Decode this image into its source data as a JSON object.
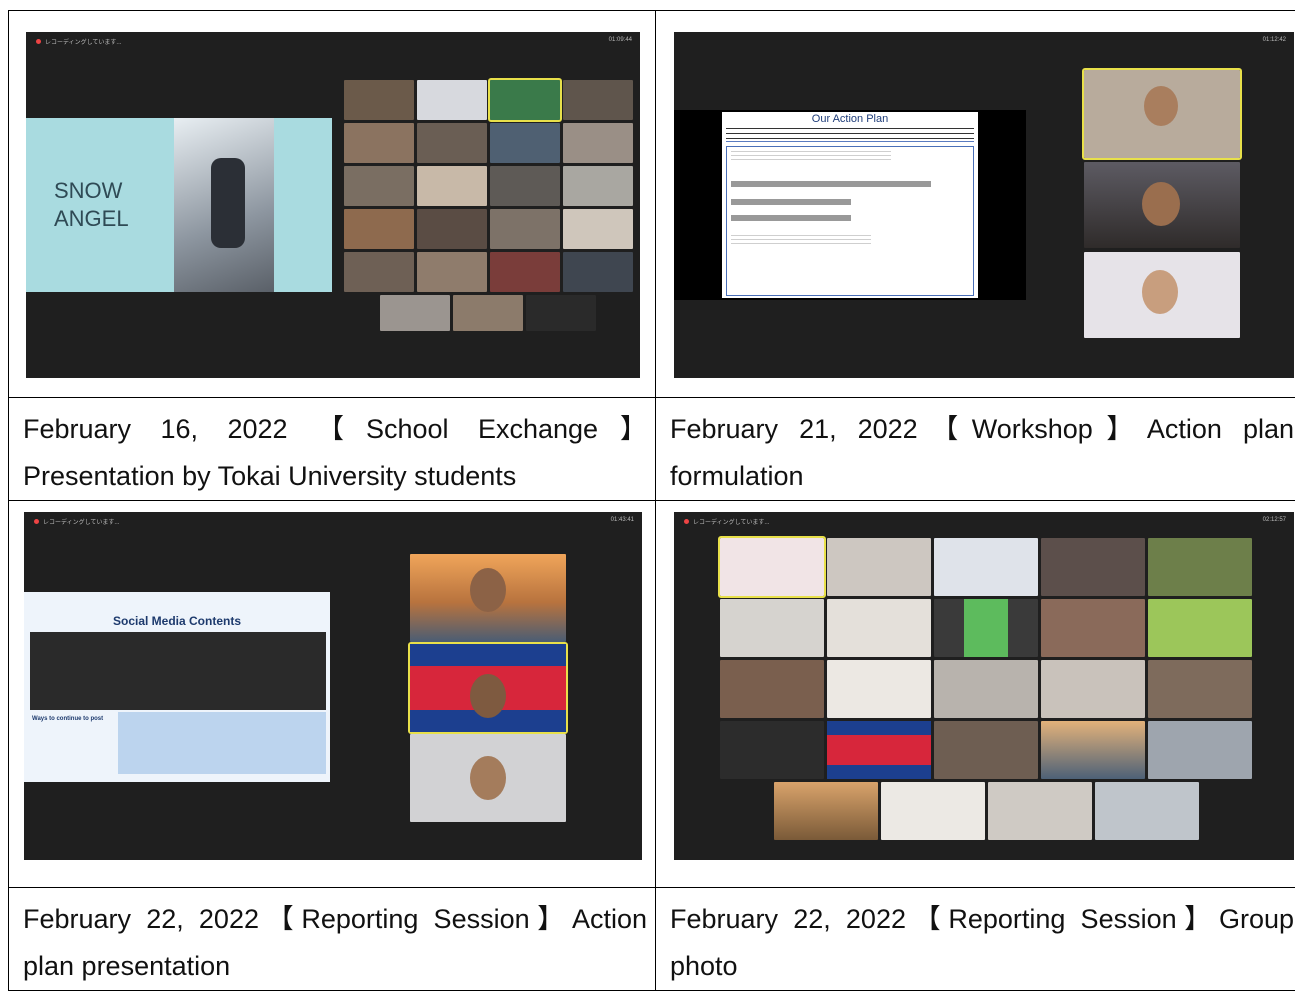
{
  "captions": [
    {
      "text": "February 16, 2022 【School Exchange】 Presentation by Tokai University students"
    },
    {
      "text": "February 21, 2022【Workshop】Action plan formulation"
    },
    {
      "text": "February 22, 2022【Reporting Session】Action plan presentation"
    },
    {
      "text": "February 22, 2022【Reporting Session】Group photo"
    }
  ],
  "shots": {
    "snow": {
      "status": "レコーディングしています...",
      "timer": "01:09:44",
      "slide_title_1": "SNOW",
      "slide_title_2": "ANGEL"
    },
    "workshop": {
      "timer": "01:12:42",
      "slide_title": "Our Action Plan"
    },
    "social": {
      "status": "レコーディングしています...",
      "timer": "01:43:41",
      "slide_title": "Social Media Contents",
      "side_heading": "Ways to continue to post"
    },
    "group": {
      "status": "レコーディングしています...",
      "timer": "02:12:57"
    }
  }
}
